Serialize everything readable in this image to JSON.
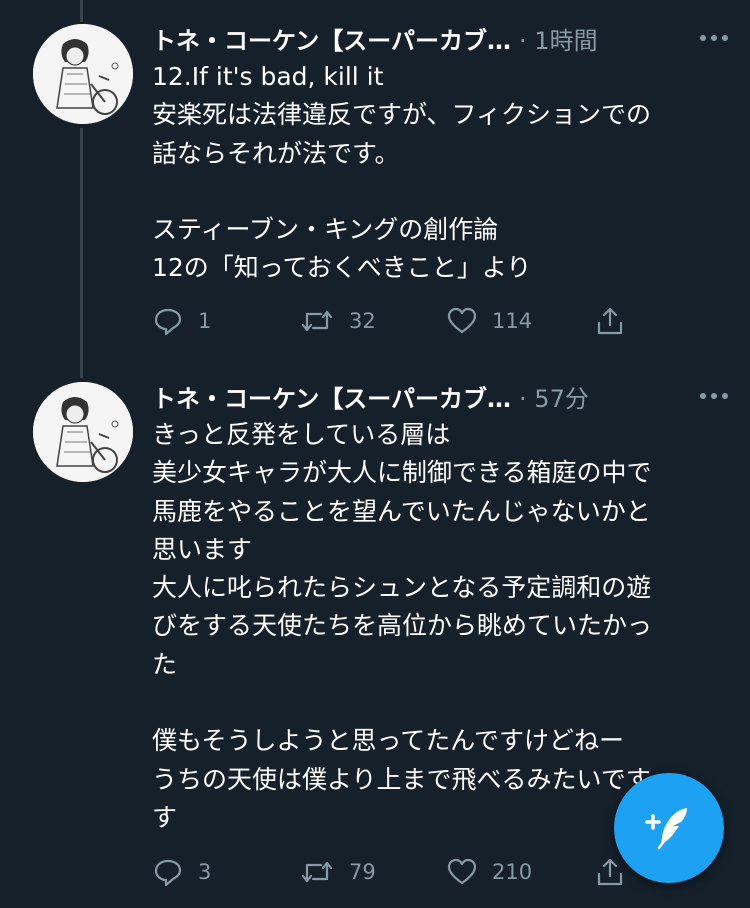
{
  "tweets": [
    {
      "author": "トネ・コーケン【スーパーカブ…",
      "time": "· 1時間",
      "text": "12.If it's bad, kill it\n安楽死は法律違反ですが、フィクションでの\n話ならそれが法です。\n\nスティーブン・キングの創作論\n12の「知っておくべきこと」より",
      "replies": "1",
      "retweets": "32",
      "likes": "114"
    },
    {
      "author": "トネ・コーケン【スーパーカブ…",
      "time": "· 57分",
      "text": "きっと反発をしている層は\n美少女キャラが大人に制御できる箱庭の中で\n馬鹿をやることを望んでいたんじゃないかと\n思います\n大人に叱られたらシュンとなる予定調和の遊\nびをする天使たちを高位から眺めていたかっ\nた\n\n僕もそうしようと思ってたんですけどねー\nうちの天使は僕より上まで飛べるみたいです\nす",
      "replies": "3",
      "retweets": "79",
      "likes": "210"
    }
  ],
  "icons": {
    "more": "more-dots-icon",
    "reply": "reply-icon",
    "retweet": "retweet-icon",
    "like": "heart-icon",
    "share": "share-icon",
    "compose": "compose-tweet-icon"
  },
  "colors": {
    "background": "#15202b",
    "secondary_text": "#8899a6",
    "accent": "#1da1f2",
    "thread_line": "#38444d"
  }
}
